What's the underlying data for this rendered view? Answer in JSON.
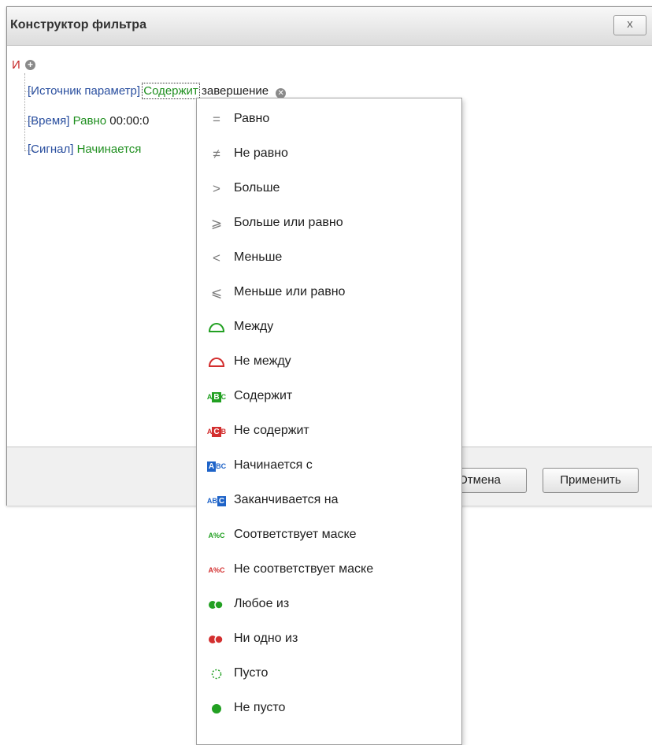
{
  "dialog": {
    "title": "Конструктор фильтра",
    "close_label": "x",
    "cancel_label": "Отмена",
    "apply_label": "Применить"
  },
  "tree": {
    "group_operator": "И",
    "conditions": [
      {
        "field": "[Источник параметр]",
        "operator": "Содержит",
        "value": "завершение"
      },
      {
        "field": "[Время]",
        "operator": "Равно",
        "value": "00:00:0"
      },
      {
        "field": "[Сигнал]",
        "operator": "Начинается",
        "value": ""
      }
    ]
  },
  "menu": {
    "items": [
      {
        "label": "Равно",
        "icon": "equals-icon"
      },
      {
        "label": "Не равно",
        "icon": "not-equals-icon"
      },
      {
        "label": "Больше",
        "icon": "greater-icon"
      },
      {
        "label": "Больше или равно",
        "icon": "greater-equal-icon"
      },
      {
        "label": "Меньше",
        "icon": "less-icon"
      },
      {
        "label": "Меньше или равно",
        "icon": "less-equal-icon"
      },
      {
        "label": "Между",
        "icon": "between-icon"
      },
      {
        "label": "Не между",
        "icon": "not-between-icon"
      },
      {
        "label": "Содержит",
        "icon": "contains-icon"
      },
      {
        "label": "Не содержит",
        "icon": "not-contains-icon"
      },
      {
        "label": "Начинается с",
        "icon": "begins-with-icon"
      },
      {
        "label": "Заканчивается на",
        "icon": "ends-with-icon"
      },
      {
        "label": "Соответствует маске",
        "icon": "like-icon"
      },
      {
        "label": "Не соответствует маске",
        "icon": "not-like-icon"
      },
      {
        "label": "Любое из",
        "icon": "any-of-icon"
      },
      {
        "label": "Ни одно из",
        "icon": "none-of-icon"
      },
      {
        "label": "Пусто",
        "icon": "is-empty-icon"
      },
      {
        "label": "Не пусто",
        "icon": "is-not-empty-icon"
      }
    ]
  },
  "colors": {
    "field": "#2a4f9f",
    "operator": "#1f8f1f",
    "group": "#c62828",
    "green_icon": "#22a022",
    "red_icon": "#d32f2f",
    "blue_icon": "#1e63c8"
  }
}
